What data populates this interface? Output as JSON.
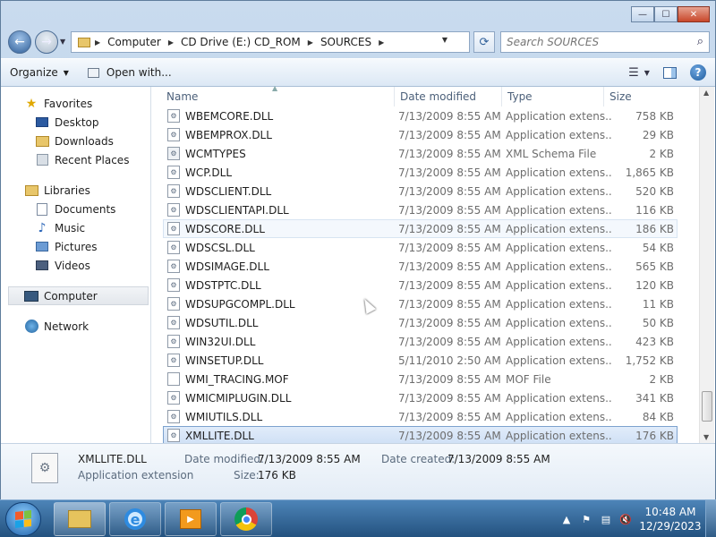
{
  "caption": {
    "min": "—",
    "max": "☐",
    "close": "✕"
  },
  "nav": {
    "back": "←",
    "forward": "→",
    "drop": "▼"
  },
  "address": {
    "crumbs": [
      "Computer",
      "CD Drive (E:) CD_ROM",
      "SOURCES"
    ],
    "refresh": "⟳"
  },
  "search": {
    "placeholder": "Search SOURCES",
    "icon": "search-icon"
  },
  "toolbar": {
    "organize": "Organize",
    "open_with": "Open with..."
  },
  "navpane": {
    "favorites": {
      "label": "Favorites",
      "items": [
        "Desktop",
        "Downloads",
        "Recent Places"
      ]
    },
    "libraries": {
      "label": "Libraries",
      "items": [
        "Documents",
        "Music",
        "Pictures",
        "Videos"
      ]
    },
    "computer": "Computer",
    "network": "Network"
  },
  "columns": {
    "name": "Name",
    "date": "Date modified",
    "type": "Type",
    "size": "Size"
  },
  "files": [
    {
      "name": "WBEMCORE.DLL",
      "date": "7/13/2009 8:55 AM",
      "type": "Application extens...",
      "size": "758 KB"
    },
    {
      "name": "WBEMPROX.DLL",
      "date": "7/13/2009 8:55 AM",
      "type": "Application extens...",
      "size": "29 KB"
    },
    {
      "name": "WCMTYPES",
      "date": "7/13/2009 8:55 AM",
      "type": "XML Schema File",
      "size": "2 KB"
    },
    {
      "name": "WCP.DLL",
      "date": "7/13/2009 8:55 AM",
      "type": "Application extens...",
      "size": "1,865 KB"
    },
    {
      "name": "WDSCLIENT.DLL",
      "date": "7/13/2009 8:55 AM",
      "type": "Application extens...",
      "size": "520 KB"
    },
    {
      "name": "WDSCLIENTAPI.DLL",
      "date": "7/13/2009 8:55 AM",
      "type": "Application extens...",
      "size": "116 KB"
    },
    {
      "name": "WDSCORE.DLL",
      "date": "7/13/2009 8:55 AM",
      "type": "Application extens...",
      "size": "186 KB"
    },
    {
      "name": "WDSCSL.DLL",
      "date": "7/13/2009 8:55 AM",
      "type": "Application extens...",
      "size": "54 KB"
    },
    {
      "name": "WDSIMAGE.DLL",
      "date": "7/13/2009 8:55 AM",
      "type": "Application extens...",
      "size": "565 KB"
    },
    {
      "name": "WDSTPTC.DLL",
      "date": "7/13/2009 8:55 AM",
      "type": "Application extens...",
      "size": "120 KB"
    },
    {
      "name": "WDSUPGCOMPL.DLL",
      "date": "7/13/2009 8:55 AM",
      "type": "Application extens...",
      "size": "11 KB"
    },
    {
      "name": "WDSUTIL.DLL",
      "date": "7/13/2009 8:55 AM",
      "type": "Application extens...",
      "size": "50 KB"
    },
    {
      "name": "WIN32UI.DLL",
      "date": "7/13/2009 8:55 AM",
      "type": "Application extens...",
      "size": "423 KB"
    },
    {
      "name": "WINSETUP.DLL",
      "date": "5/11/2010 2:50 AM",
      "type": "Application extens...",
      "size": "1,752 KB"
    },
    {
      "name": "WMI_TRACING.MOF",
      "date": "7/13/2009 8:55 AM",
      "type": "MOF File",
      "size": "2 KB"
    },
    {
      "name": "WMICMIPLUGIN.DLL",
      "date": "7/13/2009 8:55 AM",
      "type": "Application extens...",
      "size": "341 KB"
    },
    {
      "name": "WMIUTILS.DLL",
      "date": "7/13/2009 8:55 AM",
      "type": "Application extens...",
      "size": "84 KB"
    },
    {
      "name": "XMLLITE.DLL",
      "date": "7/13/2009 8:55 AM",
      "type": "Application extens...",
      "size": "176 KB"
    }
  ],
  "hover_index": 6,
  "selected_index": 17,
  "details": {
    "name": "XMLLITE.DLL",
    "type": "Application extension",
    "date_modified_label": "Date modified:",
    "date_modified": "7/13/2009 8:55 AM",
    "date_created_label": "Date created:",
    "date_created": "7/13/2009 8:55 AM",
    "size_label": "Size:",
    "size": "176 KB"
  },
  "taskbar": {
    "time": "10:48 AM",
    "date": "12/29/2023"
  },
  "colors": {
    "selection": "#cfe0f5",
    "taskbar": "#23527f",
    "accent": "#2f5f99"
  }
}
